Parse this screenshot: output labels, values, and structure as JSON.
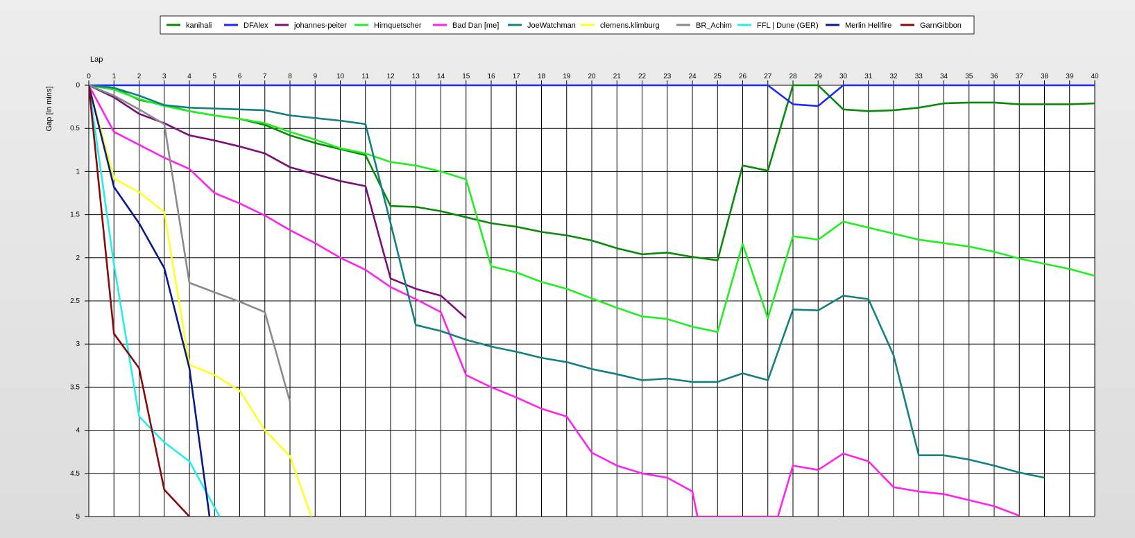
{
  "chart_data": {
    "type": "line",
    "title": "",
    "xlabel": "Lap",
    "ylabel": "Gap [in mins]",
    "xlim": [
      0,
      40
    ],
    "ylim": [
      0,
      5
    ],
    "y_inverted": true,
    "grid": true,
    "legend_position": "top-center",
    "x_ticks": [
      "0",
      "1",
      "2",
      "3",
      "4",
      "5",
      "6",
      "7",
      "8",
      "9",
      "10",
      "11",
      "12",
      "13",
      "14",
      "15",
      "16",
      "17",
      "18",
      "19",
      "20",
      "21",
      "22",
      "23",
      "24",
      "25",
      "26",
      "27",
      "28",
      "29",
      "30",
      "31",
      "32",
      "33",
      "34",
      "35",
      "36",
      "37",
      "38",
      "39",
      "40"
    ],
    "y_ticks": [
      "0",
      "0.5",
      "1",
      "1.5",
      "2",
      "2.5",
      "3",
      "3.5",
      "4",
      "4.5",
      "5"
    ],
    "series": [
      {
        "name": "kanihali",
        "color": "#0a8a0a",
        "x": [
          0,
          1,
          2,
          3,
          4,
          5,
          6,
          7,
          8,
          9,
          10,
          11,
          12,
          13,
          14,
          15,
          16,
          17,
          18,
          19,
          20,
          21,
          22,
          23,
          24,
          25,
          26,
          27,
          28,
          29,
          30,
          31,
          32,
          33,
          34,
          35,
          36,
          37,
          38,
          39,
          40
        ],
        "y": [
          0,
          0.03,
          0.17,
          0.23,
          0.3,
          0.35,
          0.39,
          0.46,
          0.58,
          0.67,
          0.74,
          0.81,
          1.4,
          1.41,
          1.46,
          1.53,
          1.6,
          1.64,
          1.7,
          1.74,
          1.8,
          1.89,
          1.96,
          1.94,
          1.99,
          2.03,
          0.93,
          0.99,
          0,
          0,
          0.28,
          0.3,
          0.29,
          0.26,
          0.21,
          0.2,
          0.2,
          0.22,
          0.22,
          0.22,
          0.21
        ]
      },
      {
        "name": "DFAlex",
        "color": "#1a2cf0",
        "x": [
          0,
          1,
          2,
          3,
          4,
          5,
          6,
          7,
          8,
          9,
          10,
          11,
          12,
          13,
          14,
          15,
          16,
          17,
          18,
          19,
          20,
          21,
          22,
          23,
          24,
          25,
          26,
          27,
          28,
          29,
          30,
          31,
          32,
          33,
          34,
          35,
          36,
          37,
          38,
          39,
          40
        ],
        "y": [
          0,
          0,
          0,
          0,
          0,
          0,
          0,
          0,
          0,
          0,
          0,
          0,
          0,
          0,
          0,
          0,
          0,
          0,
          0,
          0,
          0,
          0,
          0,
          0,
          0,
          0,
          0,
          0,
          0.22,
          0.24,
          0,
          0,
          0,
          0,
          0,
          0,
          0,
          0,
          0,
          0,
          0
        ]
      },
      {
        "name": "johannes-peiter",
        "color": "#7a107a",
        "x": [
          0,
          1,
          2,
          3,
          4,
          5,
          6,
          7,
          8,
          9,
          10,
          11,
          12,
          13,
          14,
          15
        ],
        "y": [
          0,
          0.14,
          0.33,
          0.44,
          0.58,
          0.64,
          0.71,
          0.79,
          0.95,
          1.03,
          1.11,
          1.17,
          2.24,
          2.36,
          2.44,
          2.7
        ]
      },
      {
        "name": "Hirnquetscher",
        "color": "#22ee22",
        "x": [
          0,
          1,
          2,
          3,
          4,
          5,
          6,
          7,
          8,
          9,
          10,
          11,
          12,
          13,
          14,
          15,
          16,
          17,
          18,
          19,
          20,
          21,
          22,
          23,
          24,
          25,
          26,
          27,
          28,
          29,
          30,
          31,
          32,
          33,
          34,
          35,
          36,
          37,
          38,
          39,
          40
        ],
        "y": [
          0,
          0.05,
          0.16,
          0.24,
          0.3,
          0.35,
          0.39,
          0.44,
          0.54,
          0.63,
          0.73,
          0.79,
          0.89,
          0.93,
          1.0,
          1.09,
          2.1,
          2.17,
          2.28,
          2.36,
          2.47,
          2.58,
          2.68,
          2.71,
          2.8,
          2.86,
          1.84,
          2.7,
          1.75,
          1.79,
          1.58,
          1.65,
          1.72,
          1.79,
          1.83,
          1.87,
          1.93,
          2.01,
          2.07,
          2.13,
          2.21
        ]
      },
      {
        "name": "Bad Dan [me]",
        "color": "#ff22ee",
        "x": [
          0,
          1,
          2,
          3,
          4,
          5,
          6,
          7,
          8,
          9,
          10,
          11,
          12,
          13,
          14,
          15,
          16,
          17,
          18,
          19,
          20,
          21,
          22,
          23,
          24,
          24.2,
          27.4,
          28,
          29,
          30,
          31,
          32,
          33,
          34,
          35,
          36,
          37
        ],
        "y": [
          0,
          0.54,
          0.69,
          0.84,
          0.97,
          1.25,
          1.37,
          1.51,
          1.68,
          1.83,
          2.0,
          2.14,
          2.34,
          2.48,
          2.63,
          3.36,
          3.5,
          3.62,
          3.75,
          3.84,
          4.26,
          4.41,
          4.5,
          4.55,
          4.71,
          5.0,
          5.0,
          4.41,
          4.46,
          4.27,
          4.36,
          4.66,
          4.71,
          4.74,
          4.81,
          4.88,
          4.99
        ]
      },
      {
        "name": "JoeWatchman",
        "color": "#158080",
        "x": [
          0,
          1,
          2,
          3,
          4,
          5,
          6,
          7,
          8,
          9,
          10,
          11,
          12,
          13,
          14,
          15,
          16,
          17,
          18,
          19,
          20,
          21,
          22,
          23,
          24,
          25,
          26,
          27,
          28,
          29,
          30,
          31,
          32,
          33,
          34,
          35,
          36,
          37,
          38
        ],
        "y": [
          0,
          0.03,
          0.12,
          0.23,
          0.26,
          0.27,
          0.28,
          0.29,
          0.35,
          0.38,
          0.41,
          0.45,
          1.6,
          2.78,
          2.85,
          2.95,
          3.03,
          3.09,
          3.16,
          3.21,
          3.29,
          3.35,
          3.42,
          3.4,
          3.44,
          3.44,
          3.34,
          3.42,
          2.6,
          2.61,
          2.44,
          2.48,
          3.13,
          4.29,
          4.29,
          4.34,
          4.41,
          4.49,
          4.55
        ]
      },
      {
        "name": "clemens.klimburg",
        "color": "#ffff22",
        "x": [
          0,
          1,
          2,
          3,
          4,
          5,
          6,
          7,
          8,
          8.85
        ],
        "y": [
          0,
          1.08,
          1.24,
          1.47,
          3.24,
          3.36,
          3.54,
          4.0,
          4.3,
          5.0
        ]
      },
      {
        "name": "BR_Achim",
        "color": "#8a8a8a",
        "x": [
          0,
          1,
          2,
          3,
          4,
          5,
          6,
          7,
          8
        ],
        "y": [
          0,
          0.12,
          0.28,
          0.45,
          2.29,
          2.4,
          2.51,
          2.63,
          3.67
        ]
      },
      {
        "name": "FFL | Dune (GER)",
        "color": "#22eeee",
        "x": [
          0,
          1,
          2,
          3,
          4,
          5.2
        ],
        "y": [
          0,
          2.08,
          3.84,
          4.14,
          4.36,
          5.0
        ]
      },
      {
        "name": "Merlin Hellfire",
        "color": "#0a1a8a",
        "x": [
          0,
          1,
          2,
          3,
          4,
          4.8
        ],
        "y": [
          0,
          1.18,
          1.6,
          2.12,
          3.28,
          5.0
        ]
      },
      {
        "name": "GarnGibbon",
        "color": "#880a0a",
        "x": [
          0,
          1,
          2,
          3,
          4
        ],
        "y": [
          0,
          2.88,
          3.28,
          4.69,
          5.0
        ]
      }
    ]
  }
}
